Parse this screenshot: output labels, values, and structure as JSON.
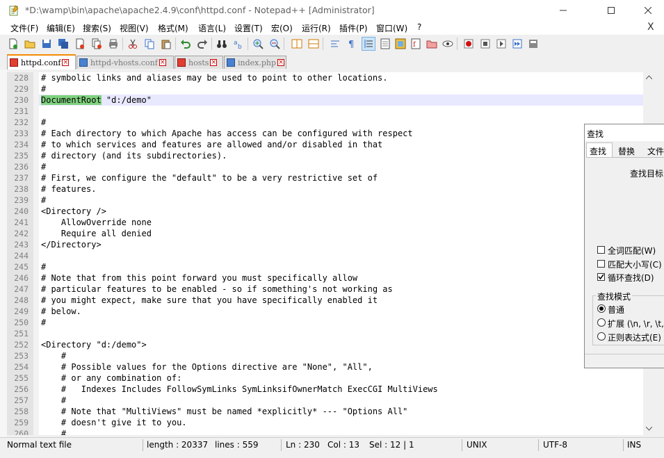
{
  "window": {
    "title": "*D:\\wamp\\bin\\apache\\apache2.4.9\\conf\\httpd.conf - Notepad++ [Administrator]"
  },
  "menu": [
    "文件(F)",
    "编辑(E)",
    "搜索(S)",
    "视图(V)",
    "格式(M)",
    "语言(L)",
    "设置(T)",
    "宏(O)",
    "运行(R)",
    "插件(P)",
    "窗口(W)",
    "?"
  ],
  "menu_close": "X",
  "tabs": [
    {
      "label": "httpd.conf",
      "active": true,
      "icon": "red-disk-icon"
    },
    {
      "label": "httpd-vhosts.conf",
      "active": false,
      "icon": "blue-disk-icon"
    },
    {
      "label": "hosts",
      "active": false,
      "icon": "red-disk-icon"
    },
    {
      "label": "index.php",
      "active": false,
      "icon": "blue-disk-icon"
    }
  ],
  "editor": {
    "current_line": 230,
    "lines": [
      {
        "n": "228",
        "t": "# symbolic links and aliases may be used to point to other locations."
      },
      {
        "n": "229",
        "t": "#"
      },
      {
        "n": "230",
        "t": "DocumentRoot \"d:/demo\"",
        "hl": "DocumentRoot"
      },
      {
        "n": "231",
        "t": ""
      },
      {
        "n": "232",
        "t": "#"
      },
      {
        "n": "233",
        "t": "# Each directory to which Apache has access can be configured with respect"
      },
      {
        "n": "234",
        "t": "# to which services and features are allowed and/or disabled in that"
      },
      {
        "n": "235",
        "t": "# directory (and its subdirectories)."
      },
      {
        "n": "236",
        "t": "#"
      },
      {
        "n": "237",
        "t": "# First, we configure the \"default\" to be a very restrictive set of"
      },
      {
        "n": "238",
        "t": "# features."
      },
      {
        "n": "239",
        "t": "#"
      },
      {
        "n": "240",
        "t": "<Directory />"
      },
      {
        "n": "241",
        "t": "    AllowOverride none"
      },
      {
        "n": "242",
        "t": "    Require all denied"
      },
      {
        "n": "243",
        "t": "</Directory>"
      },
      {
        "n": "244",
        "t": ""
      },
      {
        "n": "245",
        "t": "#"
      },
      {
        "n": "246",
        "t": "# Note that from this point forward you must specifically allow"
      },
      {
        "n": "247",
        "t": "# particular features to be enabled - so if something's not working as"
      },
      {
        "n": "248",
        "t": "# you might expect, make sure that you have specifically enabled it"
      },
      {
        "n": "249",
        "t": "# below."
      },
      {
        "n": "250",
        "t": "#"
      },
      {
        "n": "251",
        "t": ""
      },
      {
        "n": "252",
        "t": "<Directory \"d:/demo\">"
      },
      {
        "n": "253",
        "t": "    #"
      },
      {
        "n": "254",
        "t": "    # Possible values for the Options directive are \"None\", \"All\","
      },
      {
        "n": "255",
        "t": "    # or any combination of:"
      },
      {
        "n": "256",
        "t": "    #   Indexes Includes FollowSymLinks SymLinksifOwnerMatch ExecCGI MultiViews"
      },
      {
        "n": "257",
        "t": "    #"
      },
      {
        "n": "258",
        "t": "    # Note that \"MultiViews\" must be named *explicitly* --- \"Options All\""
      },
      {
        "n": "259",
        "t": "    # doesn't give it to you."
      },
      {
        "n": "260",
        "t": "    #"
      }
    ]
  },
  "status": {
    "type": "Normal text file",
    "length": "length : 20337",
    "lines": "lines : 559",
    "ln": "Ln : 230",
    "col": "Col : 13",
    "sel": "Sel : 12 | 1",
    "eol": "UNIX",
    "encoding": "UTF-8",
    "mode": "INS"
  },
  "find_dialog": {
    "title": "查找",
    "tabs": [
      "查找",
      "替换",
      "文件"
    ],
    "target_label": "查找目标",
    "options": [
      {
        "label": "全词匹配(W)",
        "checked": false
      },
      {
        "label": "匹配大小写(C)",
        "checked": false
      },
      {
        "label": "循环查找(D)",
        "checked": true
      }
    ],
    "mode_title": "查找模式",
    "modes": [
      {
        "label": "普通",
        "selected": true
      },
      {
        "label": "扩展 (\\n, \\r, \\t, \\",
        "selected": false
      },
      {
        "label": "正则表达式(E)",
        "selected": false
      }
    ]
  },
  "colors": {
    "highlight": "#7fd17f",
    "current_line": "#e8e8ff",
    "active_tab_accent": "#f48a00"
  }
}
